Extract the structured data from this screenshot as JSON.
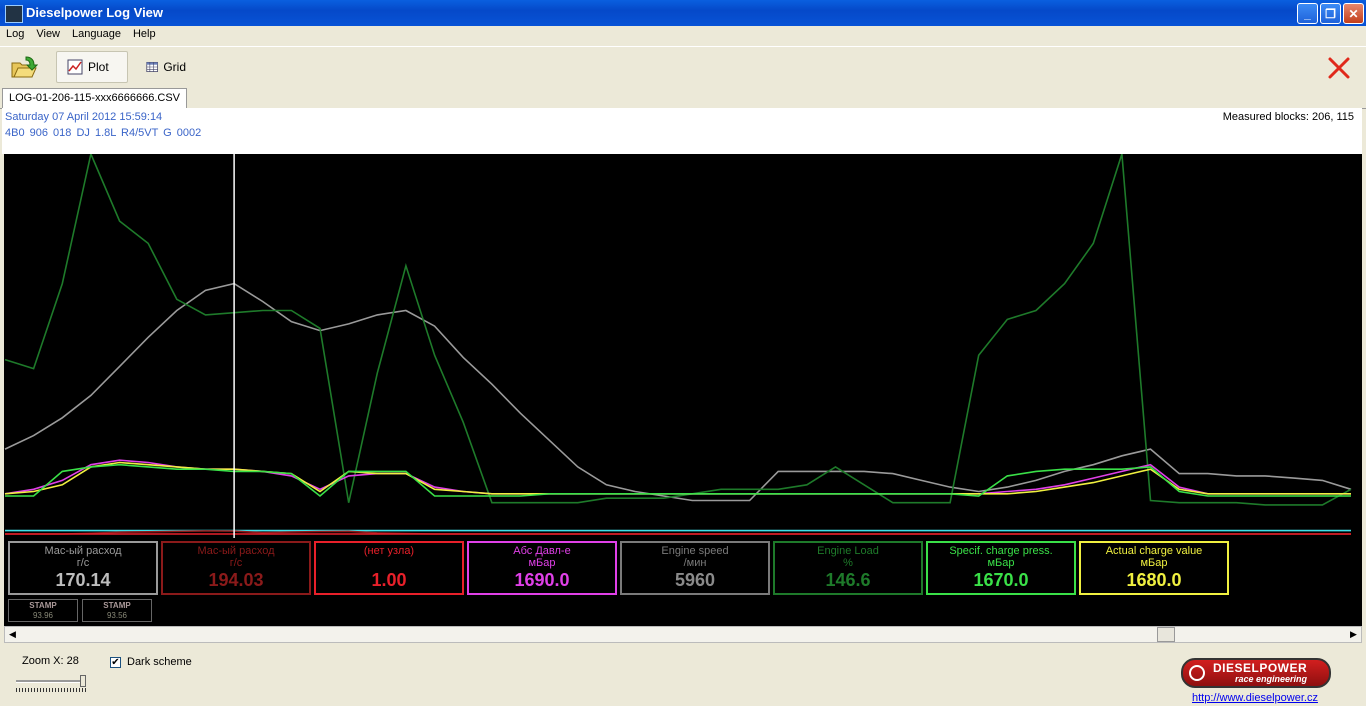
{
  "window": {
    "title": "Dieselpower Log View"
  },
  "menu": [
    "Log",
    "View",
    "Language",
    "Help"
  ],
  "toolbar": {
    "plot_label": "Plot",
    "grid_label": "Grid"
  },
  "tab": {
    "label": "LOG-01-206-115-xxx6666666.CSV"
  },
  "info": {
    "date": "Saturday 07 April 2012 15:59:14",
    "ecu": "4B0 906 018 DJ  1.8L R4/5VT     G   0002",
    "measured": "Measured blocks: 206, 115"
  },
  "cards": [
    {
      "name": "Мас-ый расход",
      "unit": "г/с",
      "value": "170.14",
      "color": "#9A9A9A",
      "value_color": "#BDBDBD"
    },
    {
      "name": "Мас-ый расход",
      "unit": "г/с",
      "value": "194.03",
      "color": "#8B1A1A",
      "value_color": "#8B1A1A"
    },
    {
      "name": "(нет узла)",
      "unit": "",
      "value": "1.00",
      "color": "#E8202A",
      "value_color": "#E8202A"
    },
    {
      "name": "Абс Давл-е",
      "unit": "мБар",
      "value": "1690.0",
      "color": "#E040E8",
      "value_color": "#E040E8"
    },
    {
      "name": "Engine speed",
      "unit": "/мин",
      "value": "5960",
      "color": "#7A7A7A",
      "value_color": "#8A8A8A"
    },
    {
      "name": "Engine Load",
      "unit": "%",
      "value": "146.6",
      "color": "#1E7A2A",
      "value_color": "#1E7A2A"
    },
    {
      "name": "Specif. charge press.",
      "unit": "мБар",
      "value": "1670.0",
      "color": "#3AE048",
      "value_color": "#3AE048"
    },
    {
      "name": "Actual charge value",
      "unit": "мБар",
      "value": "1680.0",
      "color": "#F0F040",
      "value_color": "#F0F040"
    }
  ],
  "stamps": [
    {
      "label": "STAMP",
      "value": "93.96"
    },
    {
      "label": "STAMP",
      "value": "93.56"
    }
  ],
  "bottom": {
    "zoom_label": "Zoom X: 28",
    "dark_scheme_label": "Dark scheme",
    "dark_scheme_checked": true,
    "logo_brand": "DIESELPOWER",
    "logo_sub": "race engineering",
    "url": "http://www.dieselpower.cz"
  },
  "chart_data": {
    "type": "line",
    "series": [
      {
        "color": "#9A9A9A",
        "values": [
          38,
          44,
          52,
          62,
          75,
          88,
          100,
          109,
          112,
          104,
          95,
          91,
          94,
          98,
          100,
          93,
          79,
          67,
          54,
          42,
          30,
          22,
          19,
          17,
          15,
          15,
          15,
          28,
          28,
          28,
          28,
          27,
          24,
          21,
          19,
          21,
          24,
          28,
          31,
          35,
          38,
          27,
          27,
          26,
          26,
          25,
          24,
          20
        ]
      },
      {
        "color": "#1E7A2A",
        "values": [
          78,
          74,
          112,
          170,
          140,
          130,
          105,
          98,
          99,
          100,
          100,
          92,
          14,
          72,
          120,
          80,
          50,
          14,
          14,
          14,
          14,
          16,
          16,
          16,
          18,
          20,
          20,
          20,
          22,
          30,
          22,
          14,
          14,
          14,
          80,
          96,
          100,
          112,
          130,
          170,
          15,
          14,
          14,
          14,
          13,
          13,
          13,
          20
        ]
      },
      {
        "color": "#E040E8",
        "values": [
          18,
          20,
          24,
          31,
          33,
          32,
          30,
          29,
          29,
          28,
          26,
          20,
          26,
          27,
          27,
          21,
          19,
          18,
          18,
          18,
          18,
          18,
          18,
          18,
          18,
          18,
          18,
          18,
          18,
          18,
          18,
          18,
          18,
          18,
          18,
          19,
          20,
          22,
          25,
          28,
          31,
          21,
          18,
          18,
          18,
          18,
          18,
          18
        ]
      },
      {
        "color": "#F0F040",
        "values": [
          18,
          19,
          22,
          30,
          32,
          31,
          30,
          29,
          29,
          28,
          27,
          19,
          28,
          27,
          27,
          20,
          19,
          18,
          18,
          18,
          18,
          18,
          18,
          18,
          18,
          18,
          18,
          18,
          18,
          18,
          18,
          18,
          18,
          18,
          18,
          18,
          19,
          21,
          23,
          26,
          29,
          20,
          18,
          18,
          18,
          18,
          18,
          18
        ]
      },
      {
        "color": "#3AE048",
        "values": [
          17,
          17,
          28,
          30,
          31,
          30,
          29,
          29,
          28,
          28,
          27,
          17,
          28,
          28,
          28,
          17,
          17,
          17,
          17,
          18,
          18,
          18,
          18,
          18,
          18,
          18,
          18,
          18,
          18,
          18,
          18,
          18,
          18,
          18,
          17,
          26,
          28,
          29,
          29,
          29,
          30,
          19,
          17,
          17,
          17,
          17,
          17,
          17
        ]
      },
      {
        "color": "#40E0E8",
        "values": [
          1.5,
          1.5,
          1.5,
          1.5,
          1.5,
          1.5,
          1.5,
          1.5,
          1.5,
          1.5,
          1.5,
          1.5,
          1.5,
          1.5,
          1.5,
          1.5,
          1.5,
          1.5,
          1.5,
          1.5,
          1.5,
          1.5,
          1.5,
          1.5,
          1.5,
          1.5,
          1.5,
          1.5,
          1.5,
          1.5,
          1.5,
          1.5,
          1.5,
          1.5,
          1.5,
          1.5,
          1.5,
          1.5,
          1.5,
          1.5,
          1.5,
          1.5,
          1.5,
          1.5,
          1.5,
          1.5,
          1.5,
          1.5
        ]
      },
      {
        "color": "#8B1A1A",
        "values": [
          0,
          0,
          0,
          0.3,
          0.8,
          1,
          1.2,
          1.4,
          1.3,
          0.6,
          0.9,
          1.1,
          1.2,
          0.5,
          0.2,
          0,
          0,
          0,
          0,
          0,
          0,
          0,
          0,
          0,
          0,
          0,
          0,
          0,
          0,
          0,
          0,
          0,
          0,
          0,
          0,
          0,
          0,
          0,
          0,
          0,
          0,
          0,
          0,
          0,
          0,
          0,
          0,
          0
        ]
      },
      {
        "color": "#E8202A",
        "values": [
          0,
          0,
          0,
          0,
          0,
          0,
          0,
          0,
          0,
          0,
          0,
          0,
          0,
          0,
          0,
          0,
          0,
          0,
          0,
          0,
          0,
          0,
          0,
          0,
          0,
          0,
          0,
          0,
          0,
          0,
          0,
          0,
          0,
          0,
          0,
          0,
          0,
          0,
          0,
          0,
          0,
          0,
          0,
          0,
          0,
          0,
          0,
          0
        ]
      }
    ],
    "ylim": [
      0,
      170
    ],
    "cursor_index": 8
  }
}
